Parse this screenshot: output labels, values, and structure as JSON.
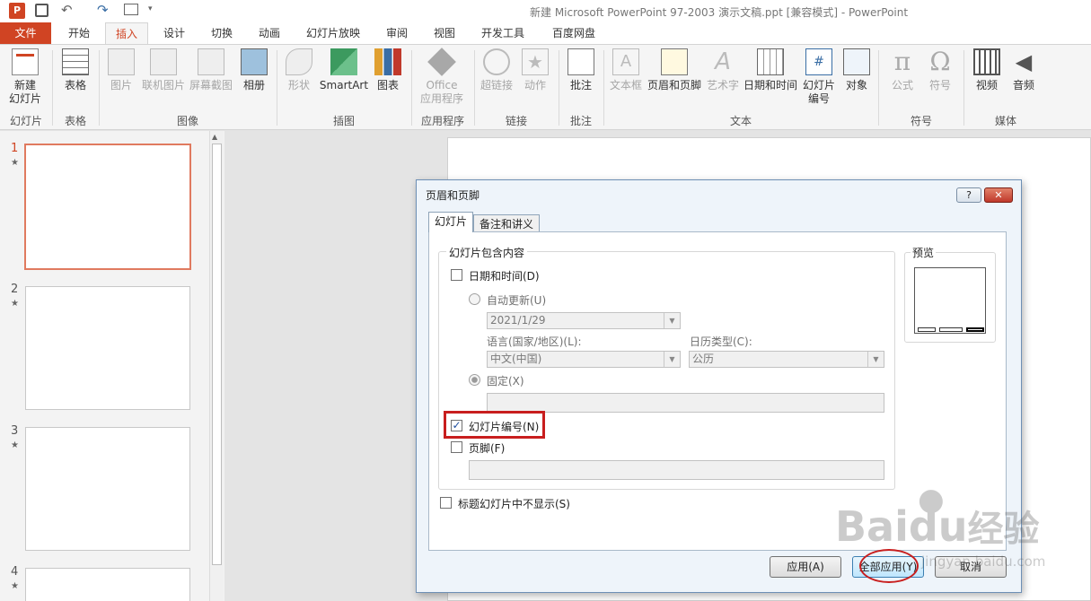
{
  "window": {
    "title": "新建 Microsoft PowerPoint 97-2003 演示文稿.ppt [兼容模式] - PowerPoint"
  },
  "tabs": [
    "文件",
    "开始",
    "插入",
    "设计",
    "切换",
    "动画",
    "幻灯片放映",
    "审阅",
    "视图",
    "开发工具",
    "百度网盘"
  ],
  "ribbon": {
    "new_slide": "新建",
    "new_slide2": "幻灯片",
    "table": "表格",
    "picture": "图片",
    "online_picture": "联机图片",
    "screenshot": "屏幕截图",
    "album": "相册",
    "shapes": "形状",
    "smartart": "SmartArt",
    "chart": "图表",
    "office": "Office",
    "apps": "应用程序",
    "hyperlink": "超链接",
    "action": "动作",
    "comment": "批注",
    "textbox": "文本框",
    "header_footer": "页眉和页脚",
    "wordart": "艺术字",
    "datetime": "日期和时间",
    "slide_number": "幻灯片",
    "slide_number2": "编号",
    "object": "对象",
    "equation": "公式",
    "symbol": "符号",
    "video": "视频",
    "audio": "音频",
    "groups": {
      "slides": "幻灯片",
      "tables": "表格",
      "images": "图像",
      "illustrations": "插图",
      "apps": "应用程序",
      "links": "链接",
      "comments": "批注",
      "text": "文本",
      "symbols": "符号",
      "media": "媒体"
    }
  },
  "thumbnails": [
    "1",
    "2",
    "3",
    "4"
  ],
  "dialog": {
    "title": "页眉和页脚",
    "tab_slide": "幻灯片",
    "tab_notes": "备注和讲义",
    "section": "幻灯片包含内容",
    "datetime": "日期和时间(D)",
    "auto_update": "自动更新(U)",
    "date_value": "2021/1/29",
    "language_label": "语言(国家/地区)(L):",
    "language_value": "中文(中国)",
    "calendar_label": "日历类型(C):",
    "calendar_value": "公历",
    "fixed": "固定(X)",
    "slide_number": "幻灯片编号(N)",
    "footer": "页脚(F)",
    "dont_show_title": "标题幻灯片中不显示(S)",
    "preview": "预览",
    "apply": "应用(A)",
    "apply_all": "全部应用(Y)",
    "cancel": "取消",
    "help": "?",
    "close": "✕"
  },
  "watermark": {
    "text": "Bai",
    "text2": "du",
    "text3": "经验",
    "sub": "jingyan.baidu.com"
  },
  "colors": {
    "accent": "#d04423",
    "highlight": "#c81e1e"
  }
}
